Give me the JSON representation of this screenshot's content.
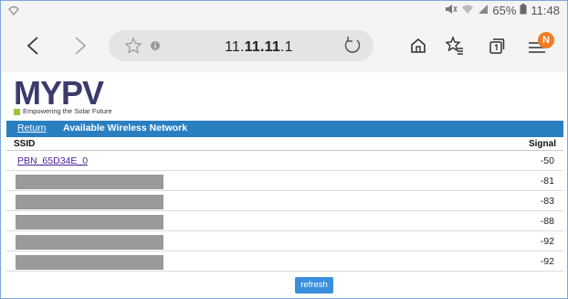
{
  "status_bar": {
    "battery_percent": "65%",
    "time": "11:48"
  },
  "browser": {
    "url_prefix": "11.",
    "url_bold": "11.11",
    "url_suffix": ".1",
    "tabs_badge": "N"
  },
  "logo": {
    "brand": "MYPV",
    "tagline": "Empowering the Solar Future"
  },
  "nav": {
    "return_label": "Return",
    "page_title": "Available Wireless Network"
  },
  "table": {
    "headers": {
      "ssid": "SSID",
      "signal": "Signal"
    },
    "rows": [
      {
        "ssid": "PBN_65D34E_0",
        "signal": "-50"
      },
      {
        "ssid": "",
        "signal": "-81"
      },
      {
        "ssid": "",
        "signal": "-83"
      },
      {
        "ssid": "",
        "signal": "-88"
      },
      {
        "ssid": "",
        "signal": "-92"
      },
      {
        "ssid": "",
        "signal": "-92"
      }
    ]
  },
  "refresh_label": "refresh",
  "colors": {
    "accent_bar": "#2a7fc1",
    "refresh_button": "#3a8fdc",
    "logo_brand": "#3b3b6b",
    "logo_leaf": "#9cc63c",
    "notification_badge": "#f47b22"
  }
}
